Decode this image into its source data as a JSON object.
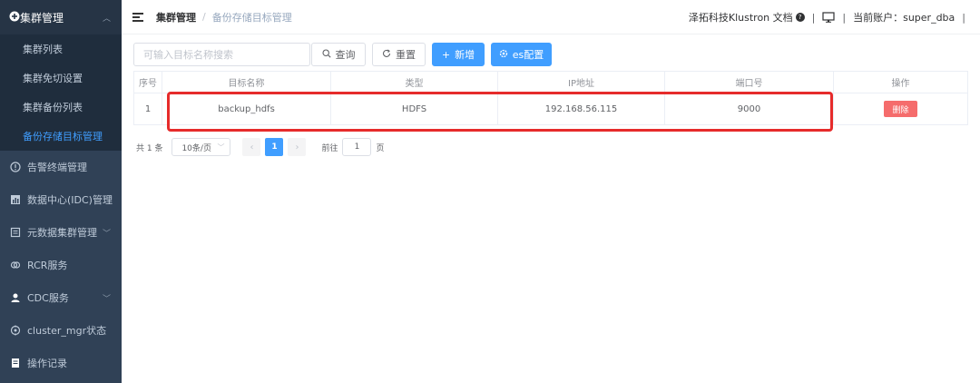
{
  "sidebar": {
    "group": {
      "label": "集群管理",
      "icon": "plus-circle-icon"
    },
    "subitems": [
      {
        "label": "集群列表"
      },
      {
        "label": "集群免切设置"
      },
      {
        "label": "集群备份列表"
      },
      {
        "label": "备份存储目标管理",
        "active": true
      }
    ],
    "items": [
      {
        "label": "告警终端管理",
        "icon": "info-icon"
      },
      {
        "label": "数据中心(IDC)管理",
        "icon": "chart-icon",
        "expandable": true
      },
      {
        "label": "元数据集群管理",
        "icon": "document-icon",
        "expandable": true
      },
      {
        "label": "RCR服务",
        "icon": "link-icon"
      },
      {
        "label": "CDC服务",
        "icon": "user-icon",
        "expandable": true
      },
      {
        "label": "cluster_mgr状态",
        "icon": "settings-icon"
      },
      {
        "label": "操作记录",
        "icon": "record-icon"
      }
    ]
  },
  "header": {
    "breadcrumb": [
      "集群管理",
      "备份存储目标管理"
    ],
    "docs_link": "泽拓科技Klustron 文档",
    "account_label": "当前账户：super_dba"
  },
  "toolbar": {
    "search_placeholder": "可输入目标名称搜索",
    "query_label": "查询",
    "reset_label": "重置",
    "add_label": "新增",
    "es_label": "es配置"
  },
  "table": {
    "columns": [
      "序号",
      "目标名称",
      "类型",
      "IP地址",
      "端口号",
      "操作"
    ],
    "rows": [
      {
        "index": "1",
        "name": "backup_hdfs",
        "type": "HDFS",
        "ip": "192.168.56.115",
        "port": "9000",
        "action": "删除"
      }
    ]
  },
  "pagination": {
    "total": "共 1 条",
    "page_size": "10条/页",
    "current_page": "1",
    "goto_label": "前往",
    "goto_value": "1",
    "page_suffix": "页"
  },
  "colors": {
    "sidebar_bg": "#304156",
    "primary": "#409eff",
    "danger": "#f56c6c",
    "highlight": "#e62b2b"
  }
}
